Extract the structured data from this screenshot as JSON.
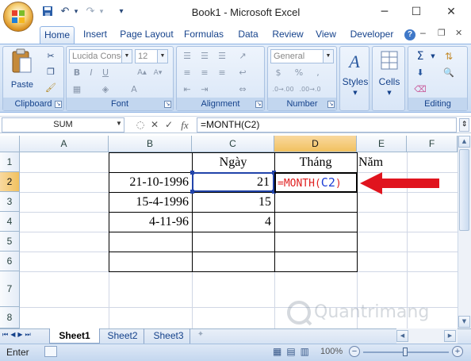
{
  "window": {
    "title": "Book1 - Microsoft Excel",
    "minimize": "─",
    "maximize": "☐",
    "close": "✕"
  },
  "quick_access": {
    "save": "💾",
    "undo": "↶",
    "redo": "↷",
    "customize": "▾"
  },
  "tabs": [
    "Home",
    "Insert",
    "Page Layout",
    "Formulas",
    "Data",
    "Review",
    "View",
    "Developer"
  ],
  "ribbon": {
    "clipboard": {
      "label": "Clipboard",
      "paste": "Paste"
    },
    "font": {
      "label": "Font",
      "font_name": "Lucida Conso",
      "font_size": "12",
      "bold": "B",
      "italic": "I",
      "underline": "U"
    },
    "alignment": {
      "label": "Alignment"
    },
    "number": {
      "label": "Number",
      "format": "General",
      "currency": "$",
      "percent": "%",
      "comma": ",",
      "dec_inc": ".0→.00",
      "dec_dec": ".00→.0"
    },
    "styles": {
      "label": "Styles"
    },
    "cells": {
      "label": "Cells"
    },
    "editing": {
      "label": "Editing",
      "sum": "Σ"
    }
  },
  "formula_bar": {
    "name_box": "SUM",
    "fx": "fx",
    "formula": "=MONTH(C2)"
  },
  "columns": [
    "A",
    "B",
    "C",
    "D",
    "E",
    "F"
  ],
  "rows": [
    "1",
    "2",
    "3",
    "4",
    "5",
    "6",
    "7",
    "8"
  ],
  "cells": {
    "C1": "Ngày",
    "D1": "Tháng",
    "E1": "Năm",
    "B2": "21-10-1996",
    "C2": "21",
    "D2_prefix": "=MONTH(",
    "D2_ref": "C2",
    "D2_suffix": ")",
    "B3": "15-4-1996",
    "C3": "15",
    "B4": "4-11-96",
    "C4": "4"
  },
  "sheets": [
    "Sheet1",
    "Sheet2",
    "Sheet3"
  ],
  "status": {
    "mode": "Enter",
    "zoom": "100%"
  },
  "watermark": "Quantrimang",
  "colors": {
    "arrow": "#e0141e",
    "formula_red": "#e02020",
    "reference_blue": "#1f3fd6",
    "ribbon_blue": "#15428b"
  }
}
